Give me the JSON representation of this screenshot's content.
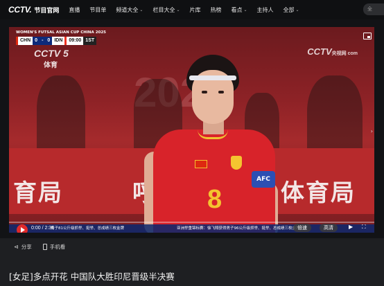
{
  "nav": {
    "logo": "CCTV.",
    "logo_sub": "节目官网",
    "items": [
      {
        "label": "直播",
        "dropdown": false
      },
      {
        "label": "节目单",
        "dropdown": false
      },
      {
        "label": "频道大全",
        "dropdown": true
      },
      {
        "label": "栏目大全",
        "dropdown": true
      },
      {
        "label": "片库",
        "dropdown": false
      },
      {
        "label": "热榜",
        "dropdown": false
      },
      {
        "label": "看点",
        "dropdown": true
      },
      {
        "label": "主持人",
        "dropdown": false
      },
      {
        "label": "全部",
        "dropdown": true
      }
    ],
    "search_placeholder": "全"
  },
  "video": {
    "scoreboard": {
      "title": "WOMEN'S FUTSAL ASIAN CUP CHINA 2025",
      "team_home": "CHN",
      "score_home": "0",
      "score_away": "0",
      "team_away": "IDN",
      "clock": "09:00",
      "period": "1ST"
    },
    "channel_logo": "CCTV 5",
    "channel_sub": "体育",
    "watermark": "CCTV",
    "watermark_sub": "央视网 com",
    "jersey_number": "8",
    "armband": "AFC",
    "banner_left": "育局",
    "banner_mid": "呼和",
    "banner_right": "体育局",
    "ticker_left": "亚洲举重锦标赛：徐飞翔获得男子96公斤级抓举、挺举、总成绩三枚金牌",
    "ticker_right": "男子81公斤级抓举、挺举、总成绩三枚金牌",
    "progress": 0.0
  },
  "controls": {
    "current_time": "0:00",
    "duration": "2:36",
    "speed_label": "倍速",
    "quality_label": "高清",
    "accent": "#e02a2a"
  },
  "share": {
    "share_label": "分享",
    "mobile_label": "手机看"
  },
  "title": "[女足]多点开花 中国队大胜印尼晋级半决赛"
}
